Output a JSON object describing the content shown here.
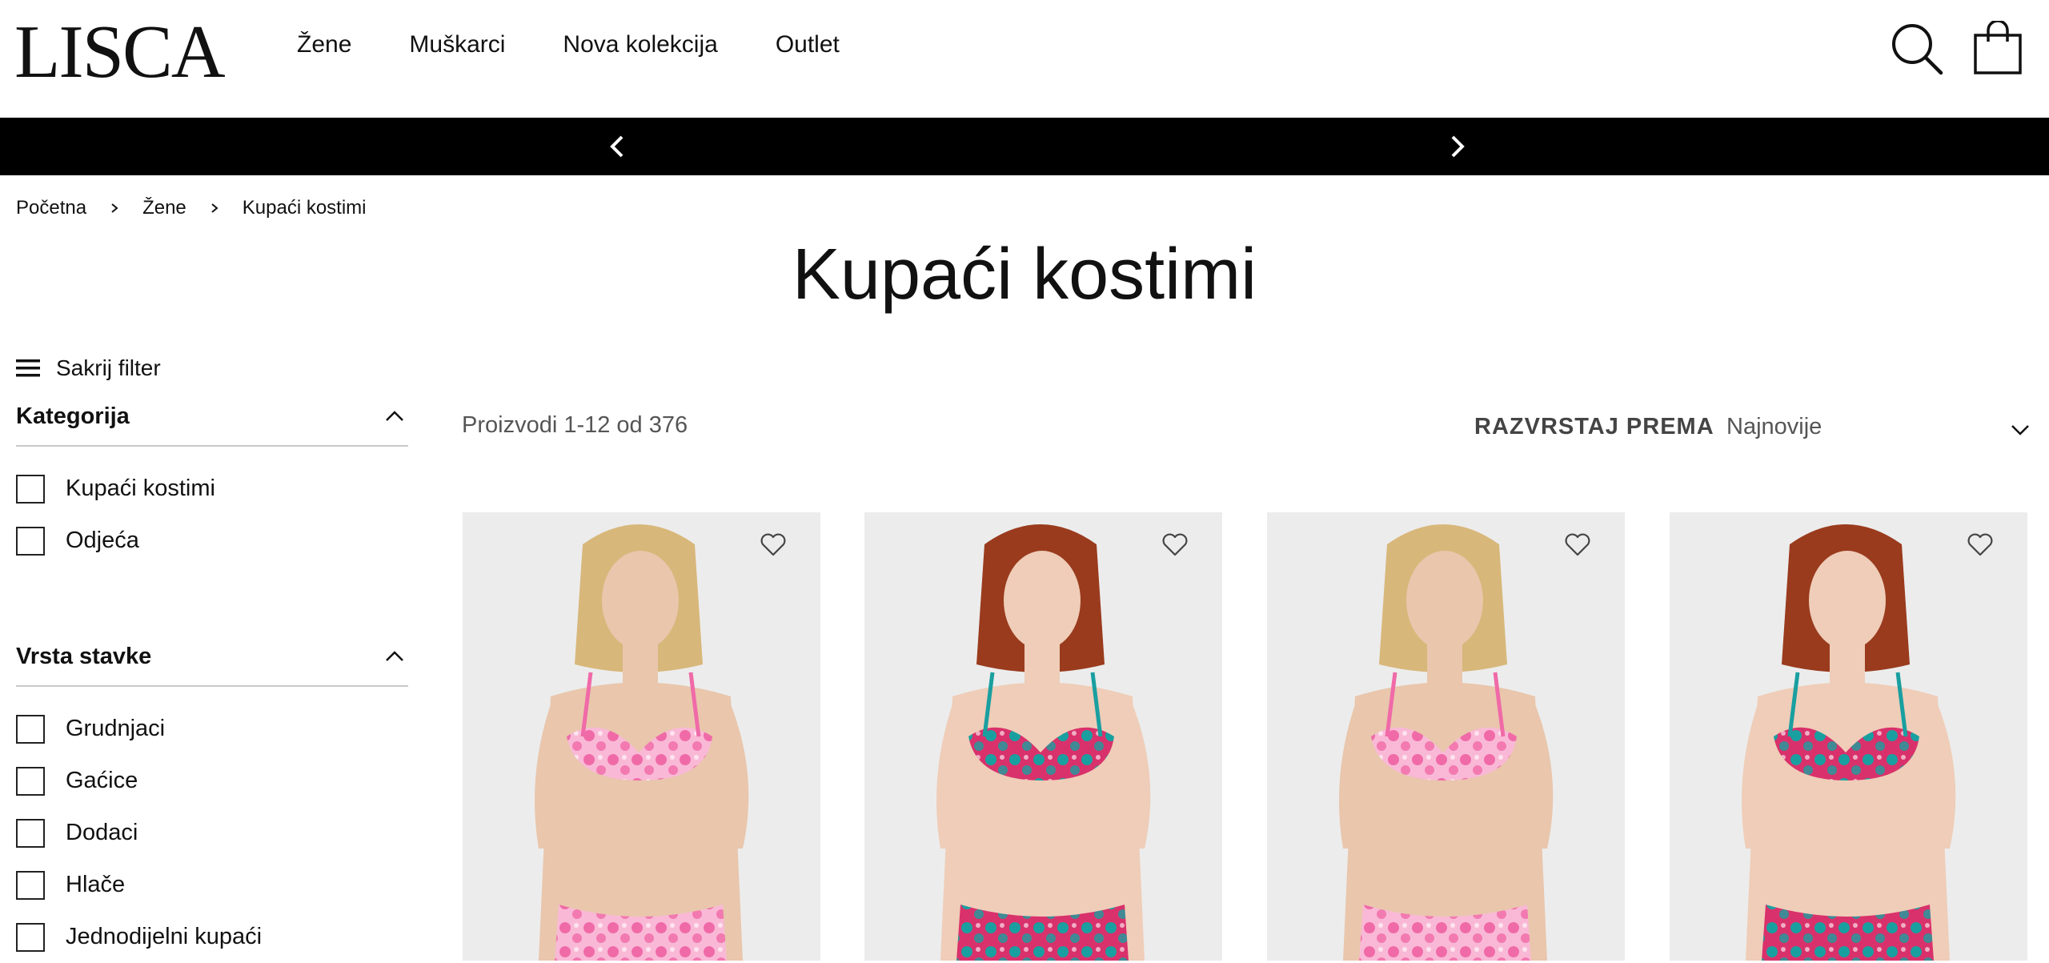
{
  "header": {
    "logo": "LISCA",
    "nav": [
      "Žene",
      "Muškarci",
      "Nova kolekcija",
      "Outlet"
    ]
  },
  "breadcrumb": [
    "Početna",
    "Žene",
    "Kupaći kostimi"
  ],
  "page_title": "Kupaći kostimi",
  "filter_toggle": "Sakrij filter",
  "filters": [
    {
      "title": "Kategorija",
      "options": [
        "Kupaći kostimi",
        "Odjeća"
      ]
    },
    {
      "title": "Vrsta stavke",
      "options": [
        "Grudnjaci",
        "Gaćice",
        "Dodaci",
        "Hlače",
        "Jednodijelni kupaći"
      ]
    }
  ],
  "toolbar": {
    "count": "Proizvodi 1-12 od 376",
    "sort_label": "RAZVRSTAJ PREMA",
    "sort_value": "Najnovije"
  },
  "products": [
    {
      "hair": "#d8b77a",
      "skin": "#e9c6ac",
      "print_a": "#f06aa8",
      "print_b": "#f9b9d6"
    },
    {
      "hair": "#9a3b1e",
      "skin": "#efcdb8",
      "print_a": "#1a9fa0",
      "print_b": "#d9316b"
    },
    {
      "hair": "#d8b77a",
      "skin": "#e9c6ac",
      "print_a": "#f06aa8",
      "print_b": "#f9b9d6"
    },
    {
      "hair": "#9a3b1e",
      "skin": "#efcdb8",
      "print_a": "#1a9fa0",
      "print_b": "#d9316b"
    }
  ],
  "colors": {
    "promo_bar": "#000000",
    "text": "#111111",
    "muted": "#555555"
  },
  "icons": [
    "search-icon",
    "shopping-bag-icon",
    "chevron-left-icon",
    "chevron-right-icon",
    "hamburger-icon",
    "chevron-up-icon",
    "chevron-down-icon",
    "heart-icon"
  ]
}
